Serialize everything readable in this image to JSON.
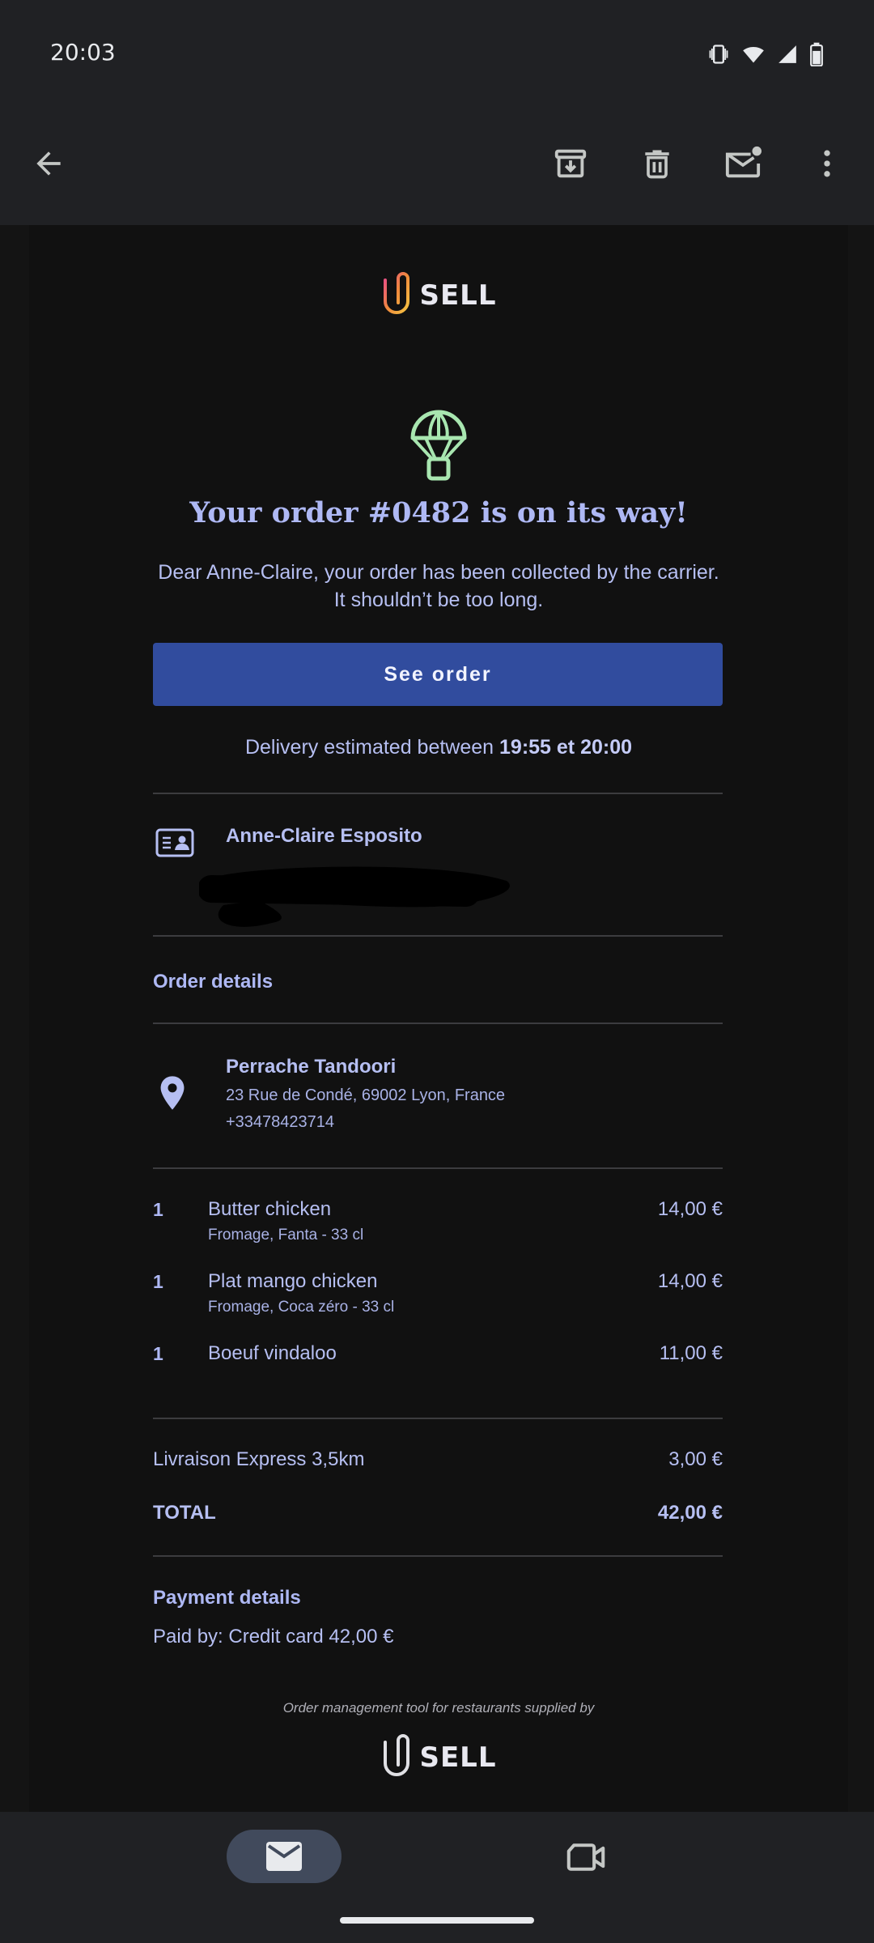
{
  "status_bar": {
    "time": "20:03"
  },
  "toolbar": {
    "back": "back-arrow-icon",
    "archive": "archive-icon",
    "delete": "trash-icon",
    "mark_unread": "mark-unread-icon",
    "more": "more-vert-icon"
  },
  "email": {
    "brand": "SELL",
    "headline": "Your order #0482 is on its way!",
    "intro": "Dear Anne-Claire, your order has been collected by the carrier. It shouldn’t be too long.",
    "cta_label": "See order",
    "eta_prefix": "Delivery estimated between",
    "eta_window": "19:55 et 20:00",
    "customer_name": "Anne-Claire Esposito",
    "order_details_title": "Order details",
    "restaurant": {
      "name": "Perrache Tandoori",
      "address": "23 Rue de Condé, 69002 Lyon, France",
      "phone": "+33478423714"
    },
    "items": [
      {
        "qty": "1",
        "name": "Butter chicken",
        "options": "Fromage, Fanta - 33 cl",
        "price": "14,00 €"
      },
      {
        "qty": "1",
        "name": "Plat mango chicken",
        "options": "Fromage, Coca zéro - 33 cl",
        "price": "14,00 €"
      },
      {
        "qty": "1",
        "name": "Boeuf vindaloo",
        "options": "",
        "price": "11,00 €"
      }
    ],
    "delivery_label": "Livraison Express 3,5km",
    "delivery_price": "3,00 €",
    "total_label": "TOTAL",
    "total_price": "42,00 €",
    "payment_title": "Payment details",
    "payment_line": "Paid by: Credit card 42,00 €",
    "footer_note": "Order management tool for restaurants supplied by",
    "footer_brand": "SELL"
  },
  "colors": {
    "accent": "#314c9e",
    "text": "#b6bff2",
    "parachute": "#a8e6b0"
  },
  "bottom_nav": {
    "mail": "mail-icon",
    "meet": "video-icon"
  }
}
